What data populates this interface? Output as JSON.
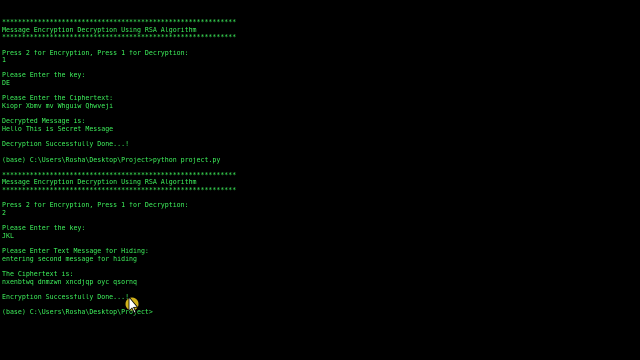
{
  "terminal": {
    "text_color": "#3ef25c",
    "background": "#000000",
    "lines": [
      "***********************************************************",
      "Message Encryption Decryption Using RSA Algorithm",
      "***********************************************************",
      "",
      "Press 2 for Encryption, Press 1 for Decryption:",
      "1",
      "",
      "Please Enter the key:",
      "DE",
      "",
      "Please Enter the Ciphertext:",
      "Kiopr Xbmv mv Whguiw Qhwveji",
      "",
      "Decrypted Message is:",
      "Hello This is Secret Message",
      "",
      "Decryption Successfully Done...!",
      "",
      "(base) C:\\Users\\Rosha\\Desktop\\Project>python project.py",
      "",
      "***********************************************************",
      "Message Encryption Decryption Using RSA Algorithm",
      "***********************************************************",
      "",
      "Press 2 for Encryption, Press 1 for Decryption:",
      "2",
      "",
      "Please Enter the key:",
      "JKL",
      "",
      "Please Enter Text Message for Hiding:",
      "entering second message for hiding",
      "",
      "The Ciphertext is:",
      "nxenbtwq dnmzwn xncdjqp oyc qsornq",
      "",
      "Encryption Successfully Done...!",
      "",
      "(base) C:\\Users\\Rosha\\Desktop\\Project>"
    ]
  },
  "cursor": {
    "icon": "mouse-cursor-icon",
    "highlight_color": "#f5d020"
  }
}
